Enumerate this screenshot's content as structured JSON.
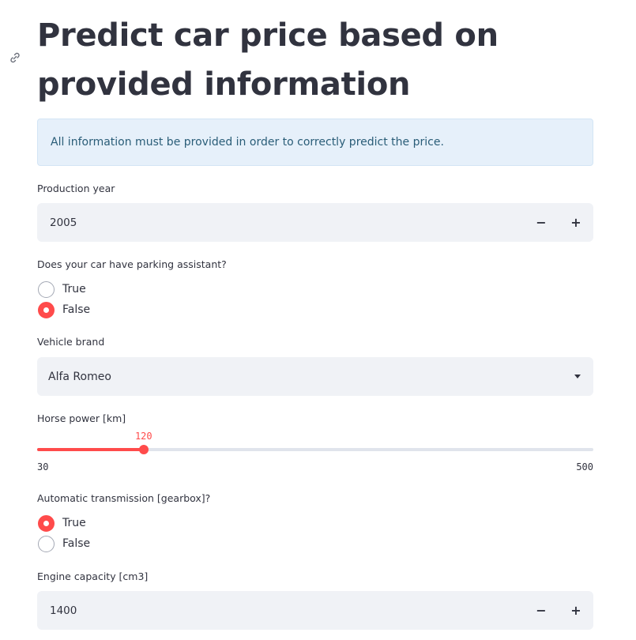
{
  "header": {
    "title": "Predict car price based on provided information",
    "link_icon": "link-icon"
  },
  "info": {
    "text": "All information must be provided in order to correctly predict the price."
  },
  "production_year": {
    "label": "Production year",
    "value": "2005",
    "decrement": "−",
    "increment": "+"
  },
  "parking_assistant": {
    "label": "Does your car have parking assistant?",
    "options": [
      "True",
      "False"
    ],
    "selected": "False"
  },
  "vehicle_brand": {
    "label": "Vehicle brand",
    "value": "Alfa Romeo"
  },
  "horse_power": {
    "label": "Horse power [km]",
    "value": "120",
    "min": "30",
    "max": "500"
  },
  "automatic_transmission": {
    "label": "Automatic transmission [gearbox]?",
    "options": [
      "True",
      "False"
    ],
    "selected": "True"
  },
  "engine_capacity": {
    "label": "Engine capacity [cm3]",
    "value": "1400",
    "decrement": "−",
    "increment": "+"
  },
  "colors": {
    "accent": "#ff4b4b",
    "input_bg": "#f0f2f6",
    "info_bg": "#e6f0fa",
    "text": "#31333f"
  }
}
